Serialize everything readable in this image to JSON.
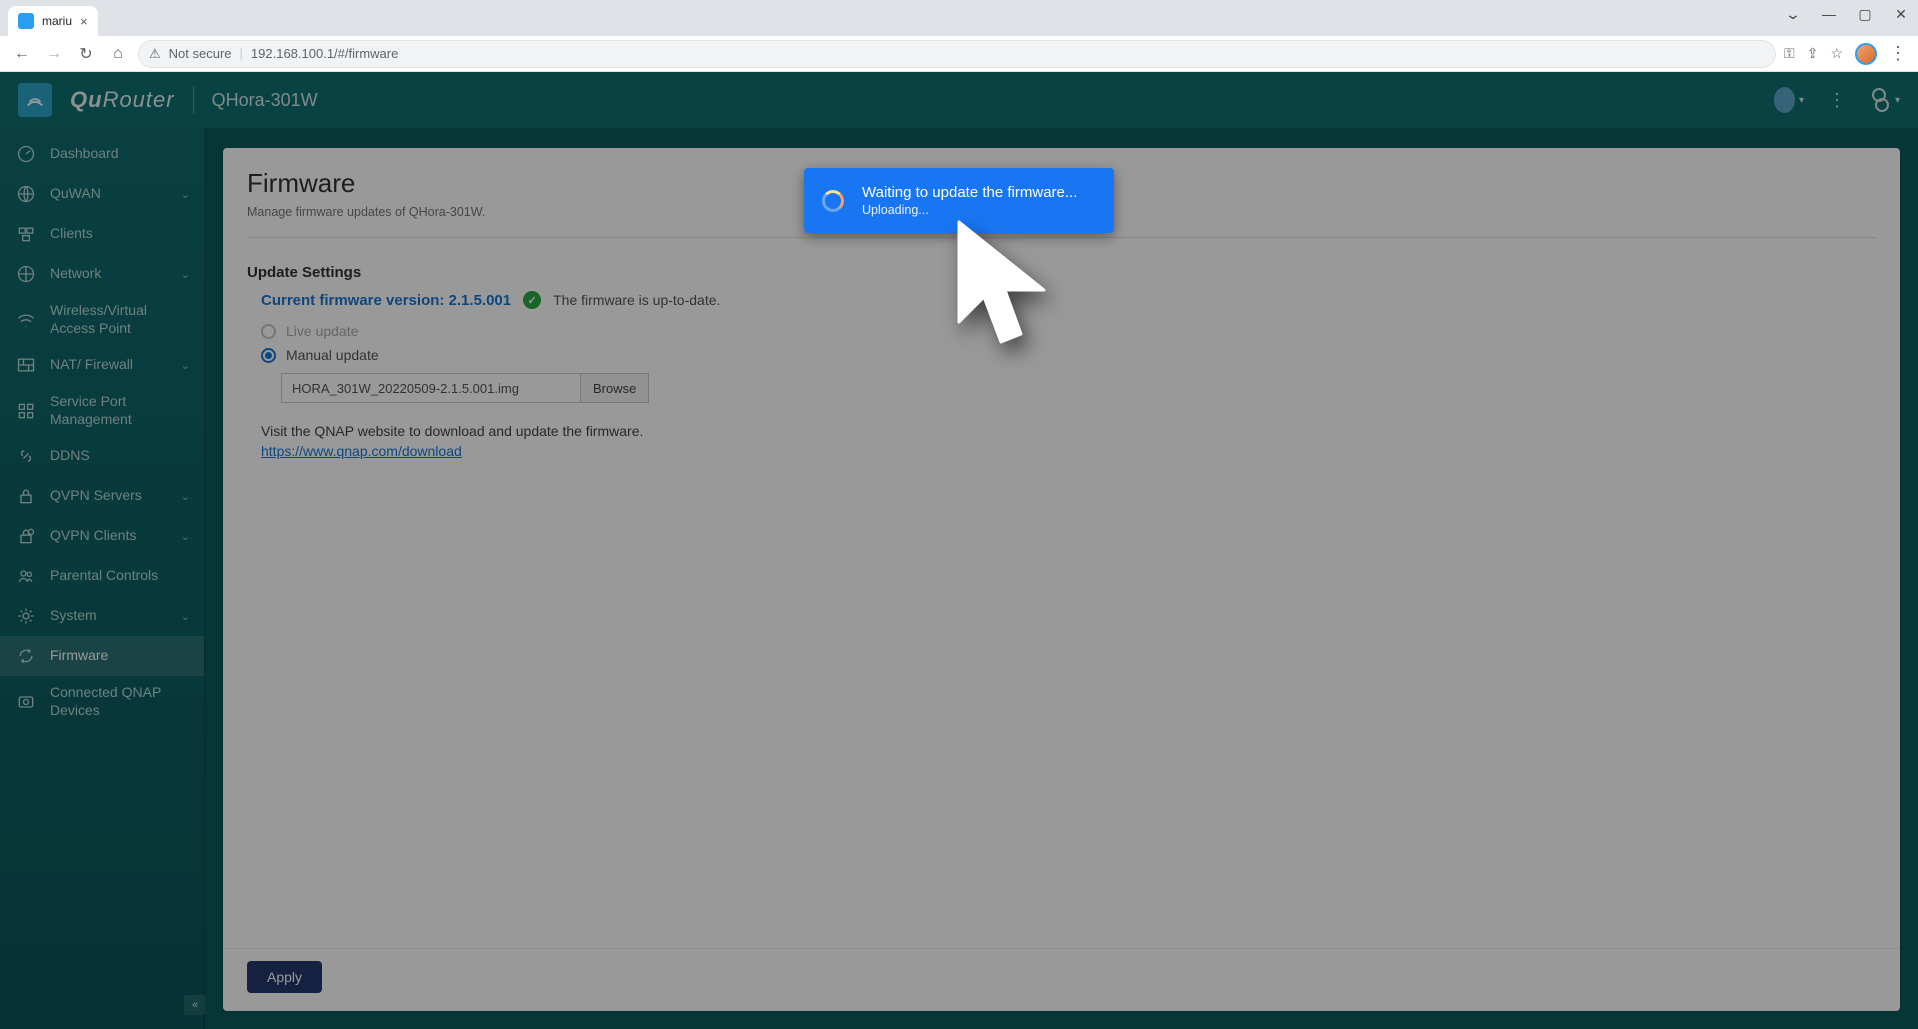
{
  "browser": {
    "tab_title": "mariu",
    "window_controls": {
      "chev": "⌄",
      "minimize": "—",
      "maximize": "▢",
      "close": "✕"
    },
    "nav": {
      "back": "←",
      "forward": "→",
      "reload": "↻",
      "home": "⌂"
    },
    "security_warn_icon": "⚠",
    "security_text": "Not secure",
    "address": "192.168.100.1/#/firmware",
    "right_icons": {
      "key": "⚿",
      "share": "⇪",
      "star": "☆",
      "menu": "⋮"
    }
  },
  "header": {
    "brand_a": "Qu",
    "brand_b": "Router",
    "product": "QHora-301W",
    "menu_glyph": "⋮"
  },
  "sidebar": {
    "items": [
      {
        "label": "Dashboard",
        "icon": "gauge",
        "expandable": false
      },
      {
        "label": "QuWAN",
        "icon": "globe2",
        "expandable": true
      },
      {
        "label": "Clients",
        "icon": "clients",
        "expandable": false
      },
      {
        "label": "Network",
        "icon": "globe",
        "expandable": true
      },
      {
        "label": "Wireless/Virtual Access Point",
        "icon": "signal",
        "expandable": false
      },
      {
        "label": "NAT/ Firewall",
        "icon": "wall",
        "expandable": true
      },
      {
        "label": "Service Port Management",
        "icon": "grid",
        "expandable": false
      },
      {
        "label": "DDNS",
        "icon": "link",
        "expandable": false
      },
      {
        "label": "QVPN Servers",
        "icon": "lock",
        "expandable": true
      },
      {
        "label": "QVPN Clients",
        "icon": "lockc",
        "expandable": true
      },
      {
        "label": "Parental Controls",
        "icon": "people",
        "expandable": false
      },
      {
        "label": "System",
        "icon": "gear",
        "expandable": true
      },
      {
        "label": "Firmware",
        "icon": "sync",
        "expandable": false,
        "active": true
      },
      {
        "label": "Connected QNAP Devices",
        "icon": "qnap",
        "expandable": false
      }
    ],
    "collapse_glyph": "«"
  },
  "page": {
    "title": "Firmware",
    "subtitle": "Manage firmware updates of QHora-301W.",
    "section_title": "Update Settings",
    "version_label": "Current firmware version: 2.1.5.001",
    "status_text": "The firmware is up-to-date.",
    "check_glyph": "✓",
    "radio_live": "Live update",
    "radio_manual": "Manual update",
    "file_name": "HORA_301W_20220509-2.1.5.001.img",
    "browse": "Browse",
    "hint_text": "Visit the QNAP website to download and update the firmware.",
    "hint_link": "https://www.qnap.com/download",
    "apply": "Apply"
  },
  "toast": {
    "title": "Waiting to update the firmware...",
    "sub": "Uploading..."
  }
}
